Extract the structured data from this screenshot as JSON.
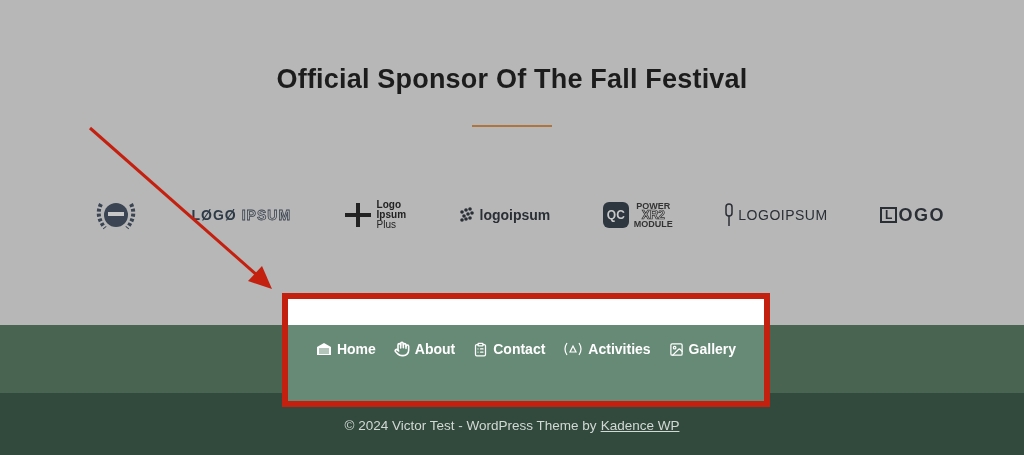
{
  "sponsor_section": {
    "title": "Official Sponsor Of The Fall Festival",
    "logos": [
      {
        "kind": "badge"
      },
      {
        "kind": "split",
        "parts": [
          "LØGØ",
          "IPSUM"
        ]
      },
      {
        "kind": "stacked",
        "lines": [
          "Logo",
          "Ipsum",
          "Plus"
        ]
      },
      {
        "kind": "icon-text",
        "text": "logoipsum"
      },
      {
        "kind": "qc",
        "badge": "QC",
        "lines": [
          "POWER",
          "XR2",
          "MODULE"
        ]
      },
      {
        "kind": "pin",
        "text": "LOGOIPSUM"
      },
      {
        "kind": "block",
        "parts": [
          "L",
          "OGO"
        ]
      }
    ]
  },
  "footer_nav": [
    {
      "label": "Home",
      "kind": "garage"
    },
    {
      "label": "About",
      "kind": "hand"
    },
    {
      "label": "Contact",
      "kind": "form"
    },
    {
      "label": "Activities",
      "kind": "alert"
    },
    {
      "label": "Gallery",
      "kind": "image"
    }
  ],
  "footer": {
    "copyright": "© 2024 Victor Test - WordPress Theme by",
    "link": "Kadence WP"
  }
}
